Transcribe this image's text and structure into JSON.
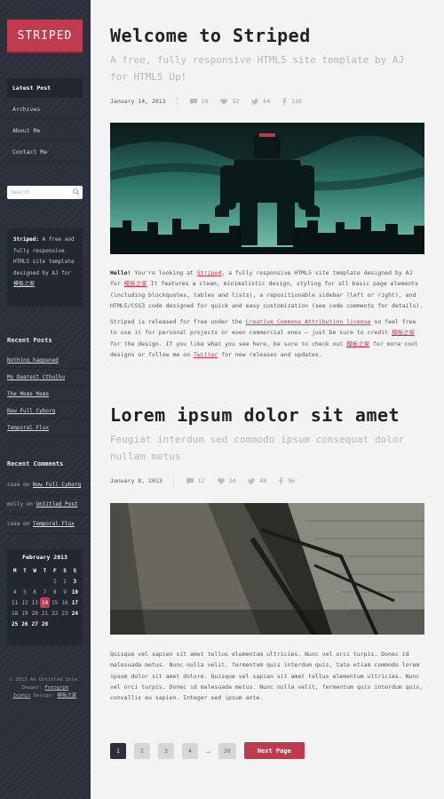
{
  "sidebar": {
    "logo": "STRIPED",
    "nav": [
      "Latest Post",
      "Archives",
      "About Me",
      "Contact Me"
    ],
    "search_placeholder": "Search",
    "about": {
      "bold": "Striped:",
      "text": " A free and fully responsive HTML5 site template designed by AJ for ",
      "link": "模板之家"
    },
    "recent_posts_title": "Recent Posts",
    "recent_posts": [
      "Nothing happened",
      "My Dearest Cthulhu",
      "The Meme Meme",
      "Now Full Cyborg",
      "Temporal Flux"
    ],
    "recent_comments_title": "Recent Comments",
    "recent_comments": [
      {
        "who": "case on ",
        "post": "Now Full Cyborg"
      },
      {
        "who": "molly on ",
        "post": "Untitled Post"
      },
      {
        "who": "case on ",
        "post": "Temporal Flux"
      }
    ],
    "calendar": {
      "title": "February 2013",
      "days": [
        "M",
        "T",
        "W",
        "T",
        "F",
        "S",
        "S"
      ],
      "rows": [
        [
          "",
          "",
          "",
          "",
          "1",
          "2",
          "3"
        ],
        [
          "4",
          "5",
          "6",
          "7",
          "8",
          "9",
          "10"
        ],
        [
          "11",
          "12",
          "13",
          "14",
          "15",
          "16",
          "17"
        ],
        [
          "18",
          "19",
          "20",
          "21",
          "22",
          "23",
          "24"
        ],
        [
          "25",
          "26",
          "27",
          "28",
          "",
          "",
          ""
        ]
      ],
      "today": "14"
    },
    "copyright": {
      "line1": "© 2013 An Untitled Site.",
      "line2": "Images: ",
      "line2_link": "Fotogrph",
      "line3_link": "Iconic",
      "line3_mid": " Design: ",
      "line3_link2": "模板之家"
    }
  },
  "posts": [
    {
      "title": "Welcome to Striped",
      "subtitle": "A free, fully responsive HTML5 site template by AJ for HTML5 Up!",
      "date": "January 14, 2013",
      "comments": "16",
      "likes": "32",
      "tweets": "64",
      "shares": "128",
      "p1": {
        "hello": "Hello!",
        "a": " You're looking at ",
        "link1": "Striped",
        "b": ", a fully responsive HTML5 site template designed by AJ for ",
        "link2": "模板之家",
        "c": " It features a clean, minimalistic design, styling for all basic page elements (including blockquotes, tables and lists), a repositionable sidebar (left or right), and HTML5/CSS3 code designed for quick and easy customization (see code comments for details)."
      },
      "p2": {
        "a": "Striped is released for free under the ",
        "link1": "Creative Commons Attribution license",
        "b": " so feel free to use it for personal projects or even commercial ones – just be sure to credit ",
        "link2": "模板之家",
        "c": " for the design. If you like what you see here, be sure to check out ",
        "link3": "模板之家",
        "d": " for more cool designs or follow me on ",
        "link4": "Twitter",
        "e": " for new releases and updates."
      }
    },
    {
      "title": "Lorem ipsum dolor sit amet",
      "subtitle": "Feugiat interdum sed commodo ipsum consequat dolor nullam metus",
      "date": "January 8, 2013",
      "comments": "12",
      "likes": "24",
      "tweets": "48",
      "shares": "96",
      "body": "Quisque vel sapien sit amet tellus elementum ultricies. Nunc vel orci turpis. Donec id malesuada metus. Nunc nulla velit, fermentum quis interdum quis, tate etiam commodo lorem ipsum dolor sit amet dolore. Quisque vel sapien sit amet tellus elementum ultricies. Nunc vel orci turpis. Donec id malesuada metus. Nunc nulla velit, fermentum quis interdum quis, convallis eu sapien. Integer sed ipsum ante."
    }
  ],
  "pagination": {
    "pages": [
      "1",
      "2",
      "3",
      "4"
    ],
    "ellipsis": "…",
    "last": "20",
    "current": 1,
    "next_label": "Next Page"
  },
  "colors": {
    "accent": "#c03a50",
    "sidebar": "#2b2f3a"
  }
}
